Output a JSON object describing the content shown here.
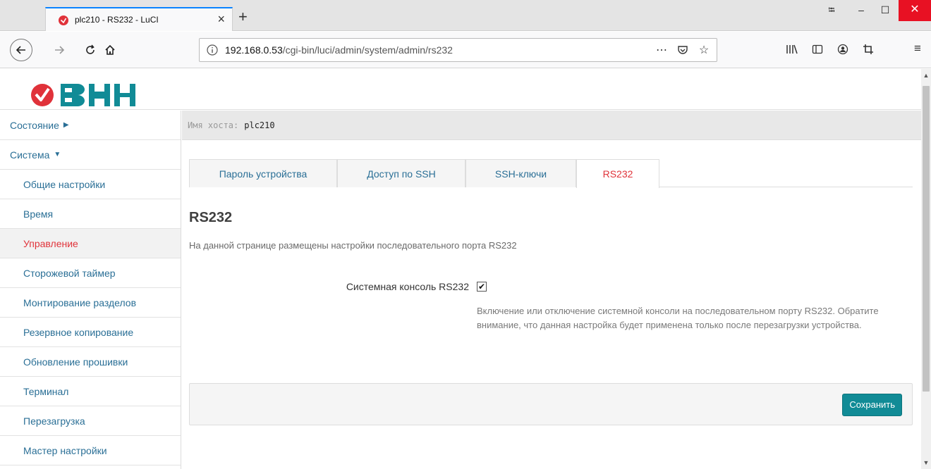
{
  "browser": {
    "tab_title": "plc210 - RS232 - LuCI",
    "url_host": "192.168.0.53",
    "url_path": "/cgi-bin/luci/admin/system/admin/rs232"
  },
  "header": {
    "hostname_label": "Имя хоста:",
    "hostname_value": "plc210"
  },
  "sidebar": {
    "items": [
      {
        "label": "Состояние",
        "type": "top",
        "caret": "right"
      },
      {
        "label": "Система",
        "type": "top",
        "caret": "down"
      },
      {
        "label": "Общие настройки",
        "type": "sub"
      },
      {
        "label": "Время",
        "type": "sub"
      },
      {
        "label": "Управление",
        "type": "sub",
        "active": true
      },
      {
        "label": "Сторожевой таймер",
        "type": "sub"
      },
      {
        "label": "Монтирование разделов",
        "type": "sub"
      },
      {
        "label": "Резервное копирование",
        "type": "sub"
      },
      {
        "label": "Обновление прошивки",
        "type": "sub"
      },
      {
        "label": "Терминал",
        "type": "sub"
      },
      {
        "label": "Перезагрузка",
        "type": "sub"
      },
      {
        "label": "Мастер настройки",
        "type": "sub"
      }
    ]
  },
  "tabs": [
    {
      "label": "Пароль устройства"
    },
    {
      "label": "Доступ по SSH"
    },
    {
      "label": "SSH-ключи"
    },
    {
      "label": "RS232",
      "active": true
    }
  ],
  "main": {
    "title": "RS232",
    "description": "На данной странице размещены настройки последовательного порта RS232",
    "field_label": "Системная консоль RS232",
    "checkbox_checked": true,
    "field_help": "Включение или отключение системной консоли на последовательном порту RS232. Обратите внимание, что данная настройка будет применена только после перезагрузки устройства.",
    "save_label": "Сохранить"
  },
  "colors": {
    "accent": "#e0333a",
    "link": "#2a6f96",
    "button": "#118b96",
    "logo": "#e0323a"
  }
}
